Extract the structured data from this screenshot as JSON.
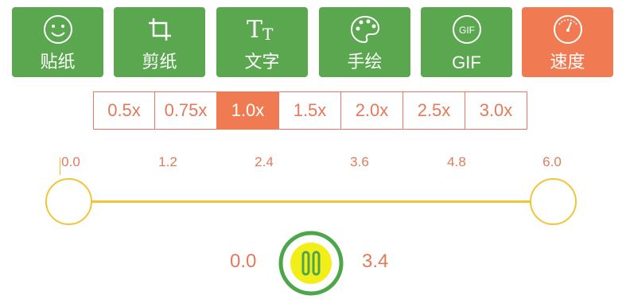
{
  "toolbar": {
    "items": [
      {
        "label": "贴纸",
        "icon": "smiley-icon",
        "active": false
      },
      {
        "label": "剪纸",
        "icon": "crop-icon",
        "active": false
      },
      {
        "label": "文字",
        "icon": "text-icon",
        "active": false
      },
      {
        "label": "手绘",
        "icon": "palette-icon",
        "active": false
      },
      {
        "label": "GIF",
        "icon": "gif-icon",
        "active": false
      },
      {
        "label": "速度",
        "icon": "speedometer-icon",
        "active": true
      }
    ],
    "colors": {
      "default": "#5aa74f",
      "active": "#f07b53"
    }
  },
  "speed": {
    "options": [
      "0.5x",
      "0.75x",
      "1.0x",
      "1.5x",
      "2.0x",
      "2.5x",
      "3.0x"
    ],
    "selected": "1.0x"
  },
  "timeline": {
    "ticks": [
      "0.0",
      "1.2",
      "2.4",
      "3.6",
      "4.8",
      "6.0"
    ]
  },
  "player": {
    "start_time": "0.0",
    "end_time": "3.4",
    "state_icon": "pause-icon"
  }
}
